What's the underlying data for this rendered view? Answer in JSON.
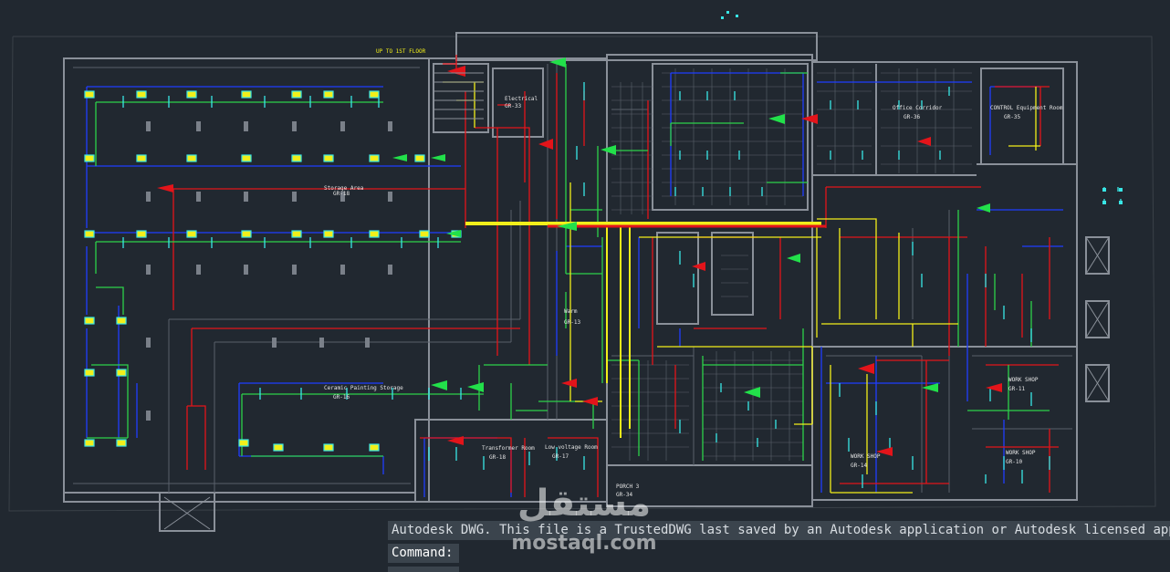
{
  "drawing": {
    "note_up_floor": "UP TO 1ST FLOOR",
    "rooms": [
      {
        "id": "storage",
        "name": "Storage Area",
        "tag": "GR-18"
      },
      {
        "id": "ceramic",
        "name": "Ceramic Painting Storage",
        "tag": "GR-16"
      },
      {
        "id": "warm",
        "name": "Warm",
        "tag": "GR-13"
      },
      {
        "id": "transformer",
        "name": "Transformer Room",
        "tag": "GR-18"
      },
      {
        "id": "lowvoltage",
        "name": "Low voltage Room",
        "tag": "GR-17"
      },
      {
        "id": "porch",
        "name": "PORCH 3",
        "tag": "GR-34"
      },
      {
        "id": "workshop1",
        "name": "WORK SHOP",
        "tag": "GR-14"
      },
      {
        "id": "workshop2",
        "name": "WORK SHOP",
        "tag": "GR-11"
      },
      {
        "id": "workshop3",
        "name": "WORK SHOP",
        "tag": "GR-10"
      },
      {
        "id": "control",
        "name": "CONTROL Equipment Room",
        "tag": "GR-35"
      },
      {
        "id": "office",
        "name": "Office Corridor",
        "tag": "GR-36"
      },
      {
        "id": "electrical",
        "name": "Electrical",
        "tag": "GR-33"
      }
    ],
    "colors": {
      "background": "#212830",
      "wall": "#8a9099",
      "circuit_blue": "#1f3dff",
      "circuit_red": "#e3141a",
      "circuit_green": "#2dd14a",
      "circuit_yellow": "#f2ef1a",
      "fixture_cyan": "#38e6e6",
      "tag_green": "#22e04a"
    }
  },
  "command": {
    "history": "Autodesk DWG.  This file is a TrustedDWG last saved by an Autodesk application or Autodesk licensed application.",
    "prompt": "Command:",
    "input_value": ""
  },
  "watermark": {
    "arabic": "مستقل",
    "latin": "mostaql.com"
  }
}
